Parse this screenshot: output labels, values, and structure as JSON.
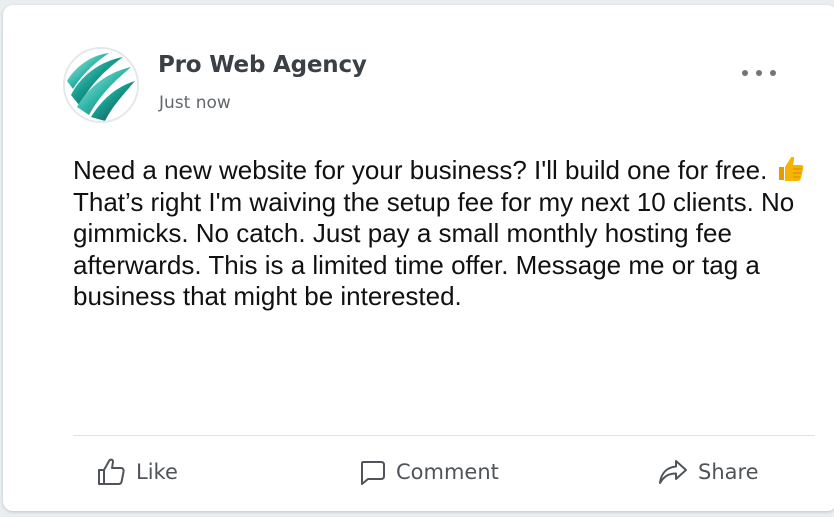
{
  "post": {
    "author": "Pro Web Agency",
    "timestamp": "Just now",
    "text_parts": [
      "Need a new website for your business? I'll build one for free. ",
      " That’s right I'm waiving the setup fee for my next 10 clients. No gimmicks. No catch. Just pay a small monthly hosting fee afterwards. This is a limited time offer. Message me or tag a business that might be interested."
    ],
    "emoji": "thumbs-up-emoji"
  },
  "actions": {
    "like_label": "Like",
    "comment_label": "Comment",
    "share_label": "Share"
  },
  "icons": {
    "more": "more-horizontal-icon",
    "like": "thumbs-up-icon",
    "comment": "comment-bubble-icon",
    "share": "share-arrow-icon"
  },
  "colors": {
    "card_background": "#ffffff",
    "page_background": "#e9eef1",
    "avatar_teal": "#1aa79a",
    "emoji_yellow": "#f6b300"
  }
}
